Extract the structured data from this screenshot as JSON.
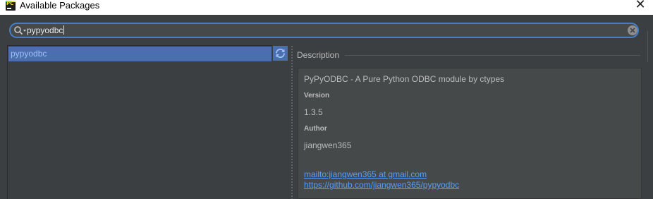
{
  "window": {
    "title": "Available Packages",
    "close_glyph": "✕",
    "icon": "pycharm-app-icon"
  },
  "search": {
    "value": "pypyodbc",
    "search_icon": "search-icon",
    "clear_icon": "clear-icon"
  },
  "packages": {
    "items": [
      {
        "name": "pypyodbc",
        "selected": true
      }
    ],
    "refresh_icon": "refresh-icon"
  },
  "description": {
    "header": "Description",
    "summary": "PyPyODBC - A Pure Python ODBC module by ctypes",
    "version_label": "Version",
    "version": "1.3.5",
    "author_label": "Author",
    "author": "jiangwen365",
    "email_link": "mailto:jiangwen365 at gmail.com",
    "homepage_link": "https://github.com/jiangwen365/pypyodbc"
  },
  "colors": {
    "background": "#3c3f41",
    "selection": "#4b6eaf",
    "focus_border": "#467ec8",
    "link": "#589df6",
    "text": "#bbbbbb"
  }
}
